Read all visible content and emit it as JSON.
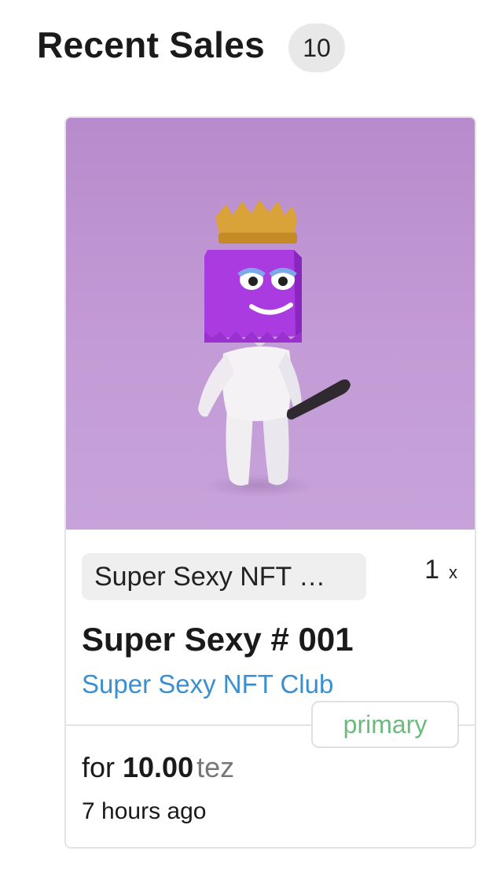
{
  "header": {
    "title": "Recent Sales",
    "count": "10"
  },
  "card": {
    "collection_chip": "Super Sexy NFT …",
    "edition_count": "1",
    "edition_x": "x",
    "token_title": "Super Sexy # 001",
    "collection_link": "Super Sexy NFT Club",
    "sale_type": "primary",
    "price_prefix": "for",
    "price_amount": "10.00",
    "price_unit": "tez",
    "time_ago": "7 hours ago"
  },
  "colors": {
    "link": "#3a8fd0",
    "primary_badge_text": "#6cba7e",
    "artwork_background": "#c59fd6",
    "character_head": "#a93be0",
    "crown": "#d9a33a"
  }
}
